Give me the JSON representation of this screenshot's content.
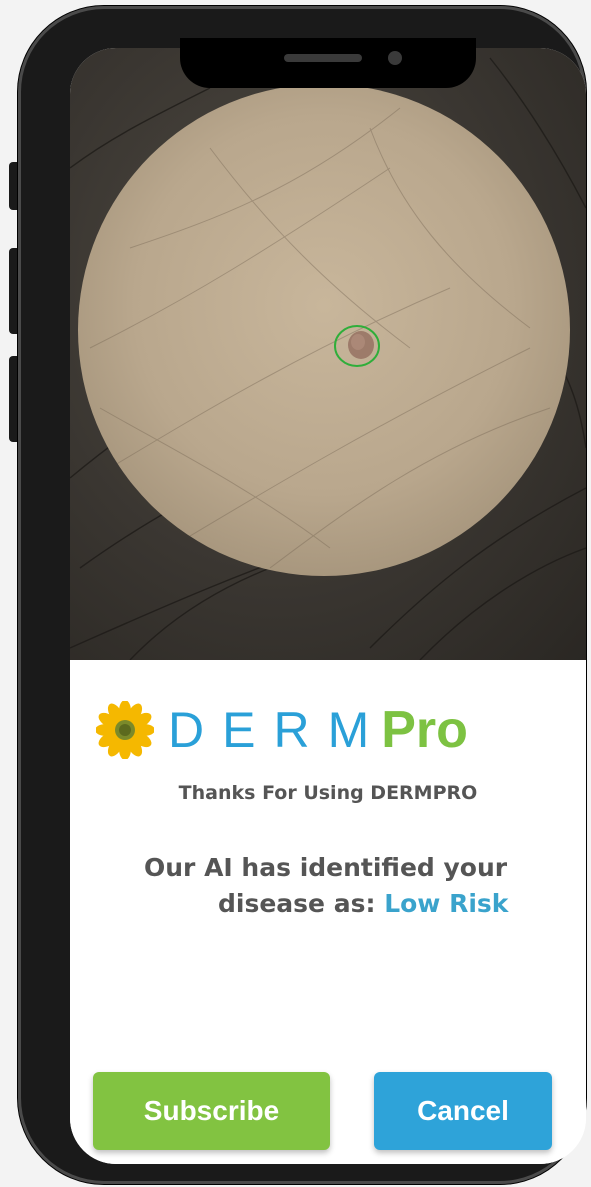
{
  "brand": {
    "derm": "DERM",
    "pro": "Pro",
    "flower_icon": "sunflower-icon",
    "colors": {
      "derm": "#2aa0d8",
      "pro": "#7dc242"
    }
  },
  "result": {
    "thanks": "Thanks For Using DERMPRO",
    "line1": "Our AI has identified your",
    "line2_prefix": "disease as:",
    "risk": "Low Risk",
    "risk_color": "#3aa3cc"
  },
  "buttons": {
    "subscribe": "Subscribe",
    "cancel": "Cancel",
    "subscribe_color": "#82c341",
    "cancel_color": "#2ea3d9"
  },
  "photo": {
    "subject": "skin-lesion-photo",
    "marker_color": "#2fae3a"
  }
}
